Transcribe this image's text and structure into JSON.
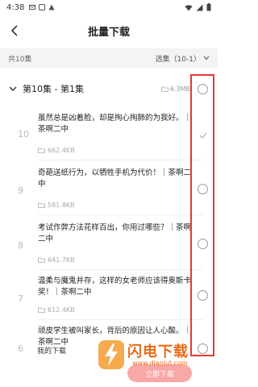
{
  "status": {
    "time": "4:38"
  },
  "header": {
    "title": "批量下载"
  },
  "summary": {
    "count_text": "共10集",
    "select_label": "选集（10-1）"
  },
  "group": {
    "title": "第10集 - 第1集",
    "size": "6.3MB"
  },
  "episodes": [
    {
      "num": "10",
      "text": "虽然总是凶着脸，却是掏心掏肺的为我好。｜茶啊二中",
      "size": "662.4KB",
      "state": "downloaded"
    },
    {
      "num": "9",
      "text": "奇葩送纸行为，以牺牲手机为代价！｜茶啊二中",
      "size": "581.8KB",
      "state": "unchecked"
    },
    {
      "num": "8",
      "text": "考试作弊方法花样百出，你用过哪些？｜茶啊二中",
      "size": "641.7KB",
      "state": "unchecked"
    },
    {
      "num": "7",
      "text": "温柔与魔鬼并存，这样的女老师应该得奥斯卡奖！｜茶啊二中",
      "size": "612.4KB",
      "state": "unchecked"
    },
    {
      "num": "6",
      "text": "顽皮学生被叫家长，背后的原因让人心酸。｜茶啊二中",
      "size": "",
      "state": "unchecked"
    }
  ],
  "footer": {
    "my_downloads": "我的下载",
    "download_button": "立即下载"
  },
  "watermark": {
    "name": "闪电下载",
    "url": "www.dianlut.com"
  },
  "colors": {
    "accent": "#e86c1a",
    "highlight_box": "#e53935",
    "button": "#f9a7a7"
  }
}
